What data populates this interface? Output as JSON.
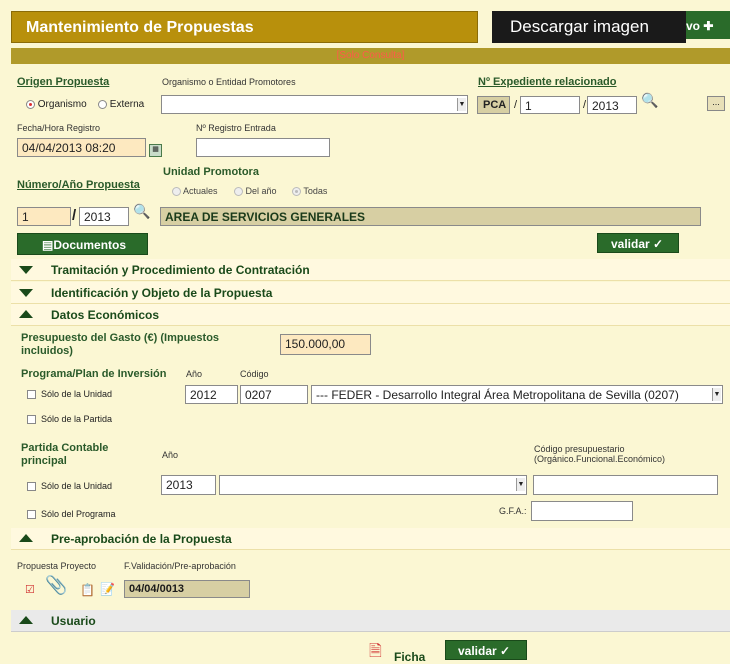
{
  "header": {
    "title": "Mantenimiento de Propuestas",
    "nuevo_label": "vo",
    "nuevo_icon": "plus-icon",
    "descargar_label": "Descargar imagen"
  },
  "banner": {
    "text": "[Solo Consulta]"
  },
  "origen": {
    "label": "Origen Propuesta",
    "options": [
      "Organismo",
      "Externa"
    ],
    "selected": "Organismo",
    "organismo_label": "Organismo o Entidad Promotores",
    "organismo_value": ""
  },
  "expediente": {
    "label": "Nº Expediente relacionado",
    "prefix": "PCA",
    "numero": "1",
    "anio": "2013",
    "more_label": "..."
  },
  "registro": {
    "fecha_label": "Fecha/Hora Registro",
    "fecha_value": "04/04/2013 08:20",
    "entrada_label": "Nº Registro Entrada",
    "entrada_value": ""
  },
  "numero_propuesta": {
    "label": "Número/Año Propuesta",
    "numero": "1",
    "anio": "2013"
  },
  "unidad": {
    "label": "Unidad Promotora",
    "options": [
      "Actuales",
      "Del año",
      "Todas"
    ],
    "selected": "Todas",
    "value": "AREA DE SERVICIOS GENERALES"
  },
  "documentos_label": "Documentos",
  "validar_label": "validar",
  "sections": {
    "tramitacion": "Tramitación y Procedimiento de Contratación",
    "identificacion": "Identificación y Objeto de la Propuesta",
    "datos_economicos": "Datos Económicos",
    "preaprobacion": "Pre-aprobación de la Propuesta",
    "usuario": "Usuario"
  },
  "economicos": {
    "presupuesto_label": "Presupuesto del Gasto (€) (Impuestos incluidos)",
    "presupuesto_value": "150.000,00",
    "programa_label": "Programa/Plan de Inversión",
    "anio_label": "Año",
    "codigo_label": "Código",
    "programa_anio": "2012",
    "programa_codigo": "0207",
    "programa_select": "--- FEDER - Desarrollo Integral Área Metropolitana de Sevilla (0207)",
    "solo_unidad_label": "Sólo de la Unidad",
    "solo_partida_label": "Sólo de la Partida",
    "partida_label": "Partida Contable principal",
    "partida_anio_label": "Año",
    "partida_anio": "2013",
    "partida_select": "",
    "codigo_presup_label": "Código presupuestario",
    "codigo_presup_sub": "(Orgánico.Funcional.Económico)",
    "codigo_presup_value": "",
    "solo_unidad2_label": "Sólo de la Unidad",
    "solo_programa_label": "Sólo del Programa",
    "gfa_label": "G.F.A.:",
    "gfa_value": ""
  },
  "preaprobacion": {
    "proyecto_label": "Propuesta Proyecto",
    "fvalidacion_label": "F.Validación/Pre-aprobación",
    "fecha_value": "04/04/0013"
  },
  "footer": {
    "ficha_label": "Ficha",
    "validar_label": "validar"
  }
}
